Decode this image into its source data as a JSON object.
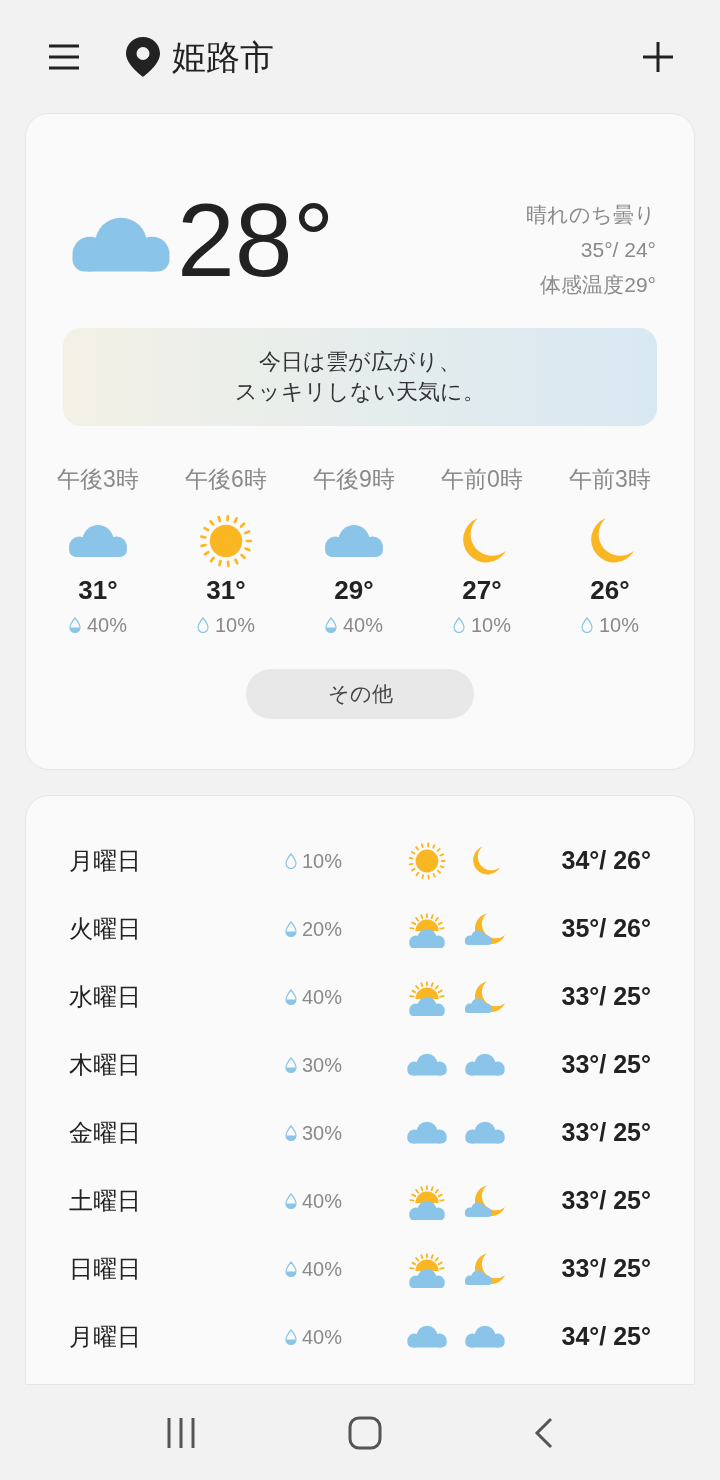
{
  "header": {
    "city": "姫路市"
  },
  "current": {
    "icon": {
      "kind": "cloudy"
    },
    "temperature": "28°",
    "condition": "晴れのち曇り",
    "high_low": "35°/ 24°",
    "feels_like": "体感温度29°",
    "summary_lines": [
      "今日は雲が広がり、",
      "スッキリしない天気に。"
    ]
  },
  "hourly": [
    {
      "time": "午後3時",
      "kind": "cloudy",
      "temperature": "31°",
      "precip": "40%",
      "drop_filled": true
    },
    {
      "time": "午後6時",
      "kind": "sunny",
      "temperature": "31°",
      "precip": "10%",
      "drop_filled": false
    },
    {
      "time": "午後9時",
      "kind": "cloudy",
      "temperature": "29°",
      "precip": "40%",
      "drop_filled": true
    },
    {
      "time": "午前0時",
      "kind": "moon",
      "temperature": "27°",
      "precip": "10%",
      "drop_filled": false
    },
    {
      "time": "午前3時",
      "kind": "moon",
      "temperature": "26°",
      "precip": "10%",
      "drop_filled": false
    }
  ],
  "more_button": "その他",
  "daily": [
    {
      "day": "月曜日",
      "precip": "10%",
      "drop_filled": false,
      "day_icon": {
        "kind": "sunny"
      },
      "night_icon": {
        "kind": "moon"
      },
      "temps": "34°/ 26°"
    },
    {
      "day": "火曜日",
      "precip": "20%",
      "drop_filled": true,
      "day_icon": {
        "kind": "sun_cloud"
      },
      "night_icon": {
        "kind": "moon_cloud"
      },
      "temps": "35°/ 26°"
    },
    {
      "day": "水曜日",
      "precip": "40%",
      "drop_filled": true,
      "day_icon": {
        "kind": "sun_cloud"
      },
      "night_icon": {
        "kind": "moon_cloud"
      },
      "temps": "33°/ 25°"
    },
    {
      "day": "木曜日",
      "precip": "30%",
      "drop_filled": true,
      "day_icon": {
        "kind": "cloudy"
      },
      "night_icon": {
        "kind": "cloudy"
      },
      "temps": "33°/ 25°"
    },
    {
      "day": "金曜日",
      "precip": "30%",
      "drop_filled": true,
      "day_icon": {
        "kind": "cloudy"
      },
      "night_icon": {
        "kind": "cloudy"
      },
      "temps": "33°/ 25°"
    },
    {
      "day": "土曜日",
      "precip": "40%",
      "drop_filled": true,
      "day_icon": {
        "kind": "sun_cloud"
      },
      "night_icon": {
        "kind": "moon_cloud"
      },
      "temps": "33°/ 25°"
    },
    {
      "day": "日曜日",
      "precip": "40%",
      "drop_filled": true,
      "day_icon": {
        "kind": "sun_cloud"
      },
      "night_icon": {
        "kind": "moon_cloud"
      },
      "temps": "33°/ 25°"
    },
    {
      "day": "月曜日",
      "precip": "40%",
      "drop_filled": true,
      "day_icon": {
        "kind": "cloudy"
      },
      "night_icon": {
        "kind": "cloudy"
      },
      "temps": "34°/ 25°"
    }
  ]
}
